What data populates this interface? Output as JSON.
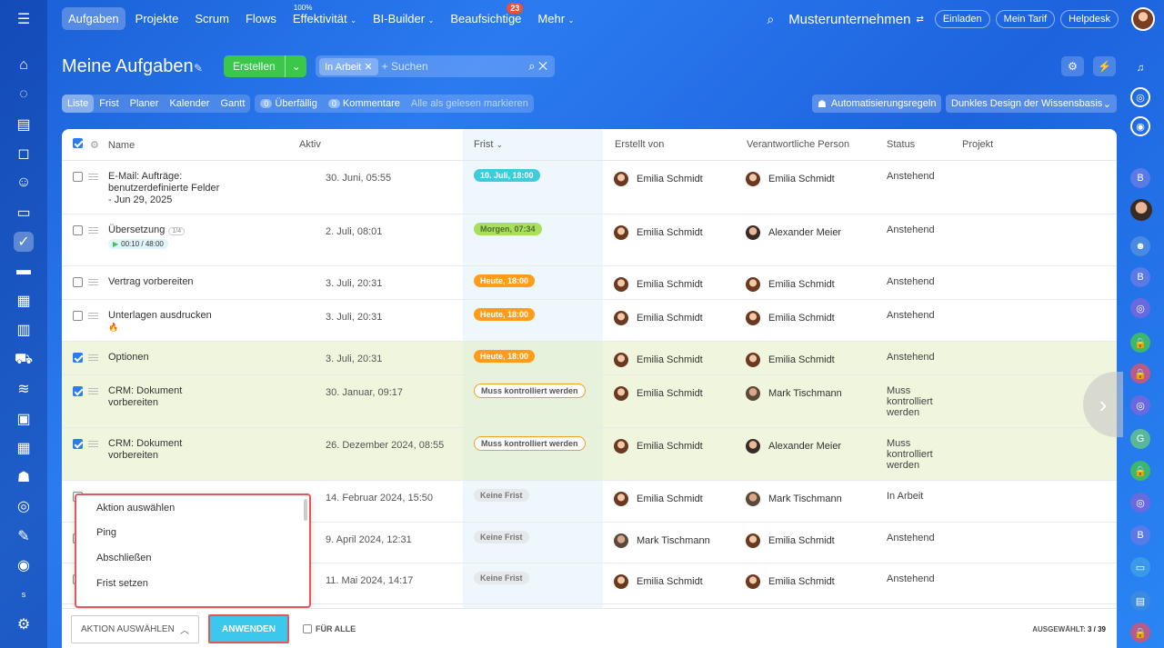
{
  "topnav": {
    "items": [
      {
        "label": "Aufgaben",
        "active": true
      },
      {
        "label": "Projekte"
      },
      {
        "label": "Scrum"
      },
      {
        "label": "Flows"
      },
      {
        "label": "Effektivität",
        "sup": "100%",
        "caret": true
      },
      {
        "label": "BI-Builder",
        "caret": true
      },
      {
        "label": "Beaufsichtige",
        "badge": "23"
      },
      {
        "label": "Mehr",
        "caret": true
      }
    ],
    "company": "Musterunternehmen",
    "invite": "Einladen",
    "plan": "Mein Tarif",
    "helpdesk": "Helpdesk"
  },
  "page": {
    "title": "Meine Aufgaben",
    "create": "Erstellen",
    "filter_chip": "In Arbeit",
    "search_placeholder": "+ Suchen"
  },
  "views": {
    "tabs": [
      "Liste",
      "Frist",
      "Planer",
      "Kalender",
      "Gantt"
    ],
    "overdue_count": "0",
    "overdue": "Überfällig",
    "comments_count": "0",
    "comments": "Kommentare",
    "mark_read": "Alle als gelesen markieren",
    "automation": "Automatisierungsregeln",
    "design": "Dunkles Design der Wissensbasis"
  },
  "table": {
    "headers": {
      "name": "Name",
      "active": "Aktiv",
      "deadline": "Frist",
      "created_by": "Erstellt von",
      "responsible": "Verantwortliche Person",
      "status": "Status",
      "project": "Projekt"
    },
    "rows": [
      {
        "name": "E-Mail: Aufträge: benutzerdefinierte Felder - Jun 29, 2025",
        "active": "30. Juni, 05:55",
        "deadline": "10. Juli, 18:00",
        "dcolor": "#3fcbdc",
        "creator": "Emilia Schmidt",
        "responsible": "Emilia Schmidt",
        "status": "Anstehend",
        "checked": false
      },
      {
        "name": "Übersetzung",
        "checklist": "1/4",
        "timer": "00:10 / 48:00",
        "active": "2. Juli, 08:01",
        "deadline": "Morgen, 07:34",
        "dcolor": "#a8df5d",
        "dtext": "#556b2f",
        "creator": "Emilia Schmidt",
        "responsible": "Alexander Meier",
        "status": "Anstehend",
        "checked": false
      },
      {
        "name": "Vertrag vorbereiten",
        "active": "3. Juli, 20:31",
        "deadline": "Heute, 18:00",
        "dcolor": "#ff9d1a",
        "creator": "Emilia Schmidt",
        "responsible": "Emilia Schmidt",
        "status": "Anstehend",
        "checked": false
      },
      {
        "name": "Unterlagen ausdrucken",
        "fire": "🔥",
        "active": "3. Juli, 20:31",
        "deadline": "Heute, 18:00",
        "dcolor": "#ff9d1a",
        "creator": "Emilia Schmidt",
        "responsible": "Emilia Schmidt",
        "status": "Anstehend",
        "checked": false
      },
      {
        "name": "Optionen",
        "active": "3. Juli, 20:31",
        "deadline": "Heute, 18:00",
        "dcolor": "#ff9d1a",
        "creator": "Emilia Schmidt",
        "responsible": "Emilia Schmidt",
        "status": "Anstehend",
        "checked": true
      },
      {
        "name": "CRM: Dokument vorbereiten",
        "active": "30. Januar, 09:17",
        "deadline": "Muss kontrolliert werden",
        "outline": true,
        "creator": "Emilia Schmidt",
        "responsible": "Mark Tischmann",
        "status": "Muss kontrolliert werden",
        "checked": true
      },
      {
        "name": "CRM: Dokument vorbereiten",
        "active": "26. Dezember 2024, 08:55",
        "deadline": "Muss kontrolliert werden",
        "outline": true,
        "creator": "Emilia Schmidt",
        "responsible": "Alexander Meier",
        "status": "Muss kontrolliert werden",
        "checked": true
      },
      {
        "name": "",
        "active": "14. Februar 2024, 15:50",
        "deadline": "Keine Frist",
        "gray": true,
        "creator": "Emilia Schmidt",
        "responsible": "Mark Tischmann",
        "status": "In Arbeit",
        "checked": false
      },
      {
        "name": "",
        "active": "9. April 2024, 12:31",
        "deadline": "Keine Frist",
        "gray": true,
        "creator": "Mark Tischmann",
        "responsible": "Emilia Schmidt",
        "status": "Anstehend",
        "checked": false
      },
      {
        "name": "",
        "active": "11. Mai 2024, 14:17",
        "deadline": "Keine Frist",
        "gray": true,
        "creator": "Emilia Schmidt",
        "responsible": "Emilia Schmidt",
        "status": "Anstehend",
        "checked": false
      }
    ]
  },
  "dropdown": {
    "options": [
      "Aktion auswählen",
      "Ping",
      "Abschließen",
      "Frist setzen"
    ]
  },
  "footer": {
    "action_select": "AKTION AUSWÄHLEN",
    "apply": "ANWENDEN",
    "for_all": "FÜR ALLE",
    "selected_label": "AUSGEWÄHLT:",
    "selected_value": "3 / 39"
  }
}
